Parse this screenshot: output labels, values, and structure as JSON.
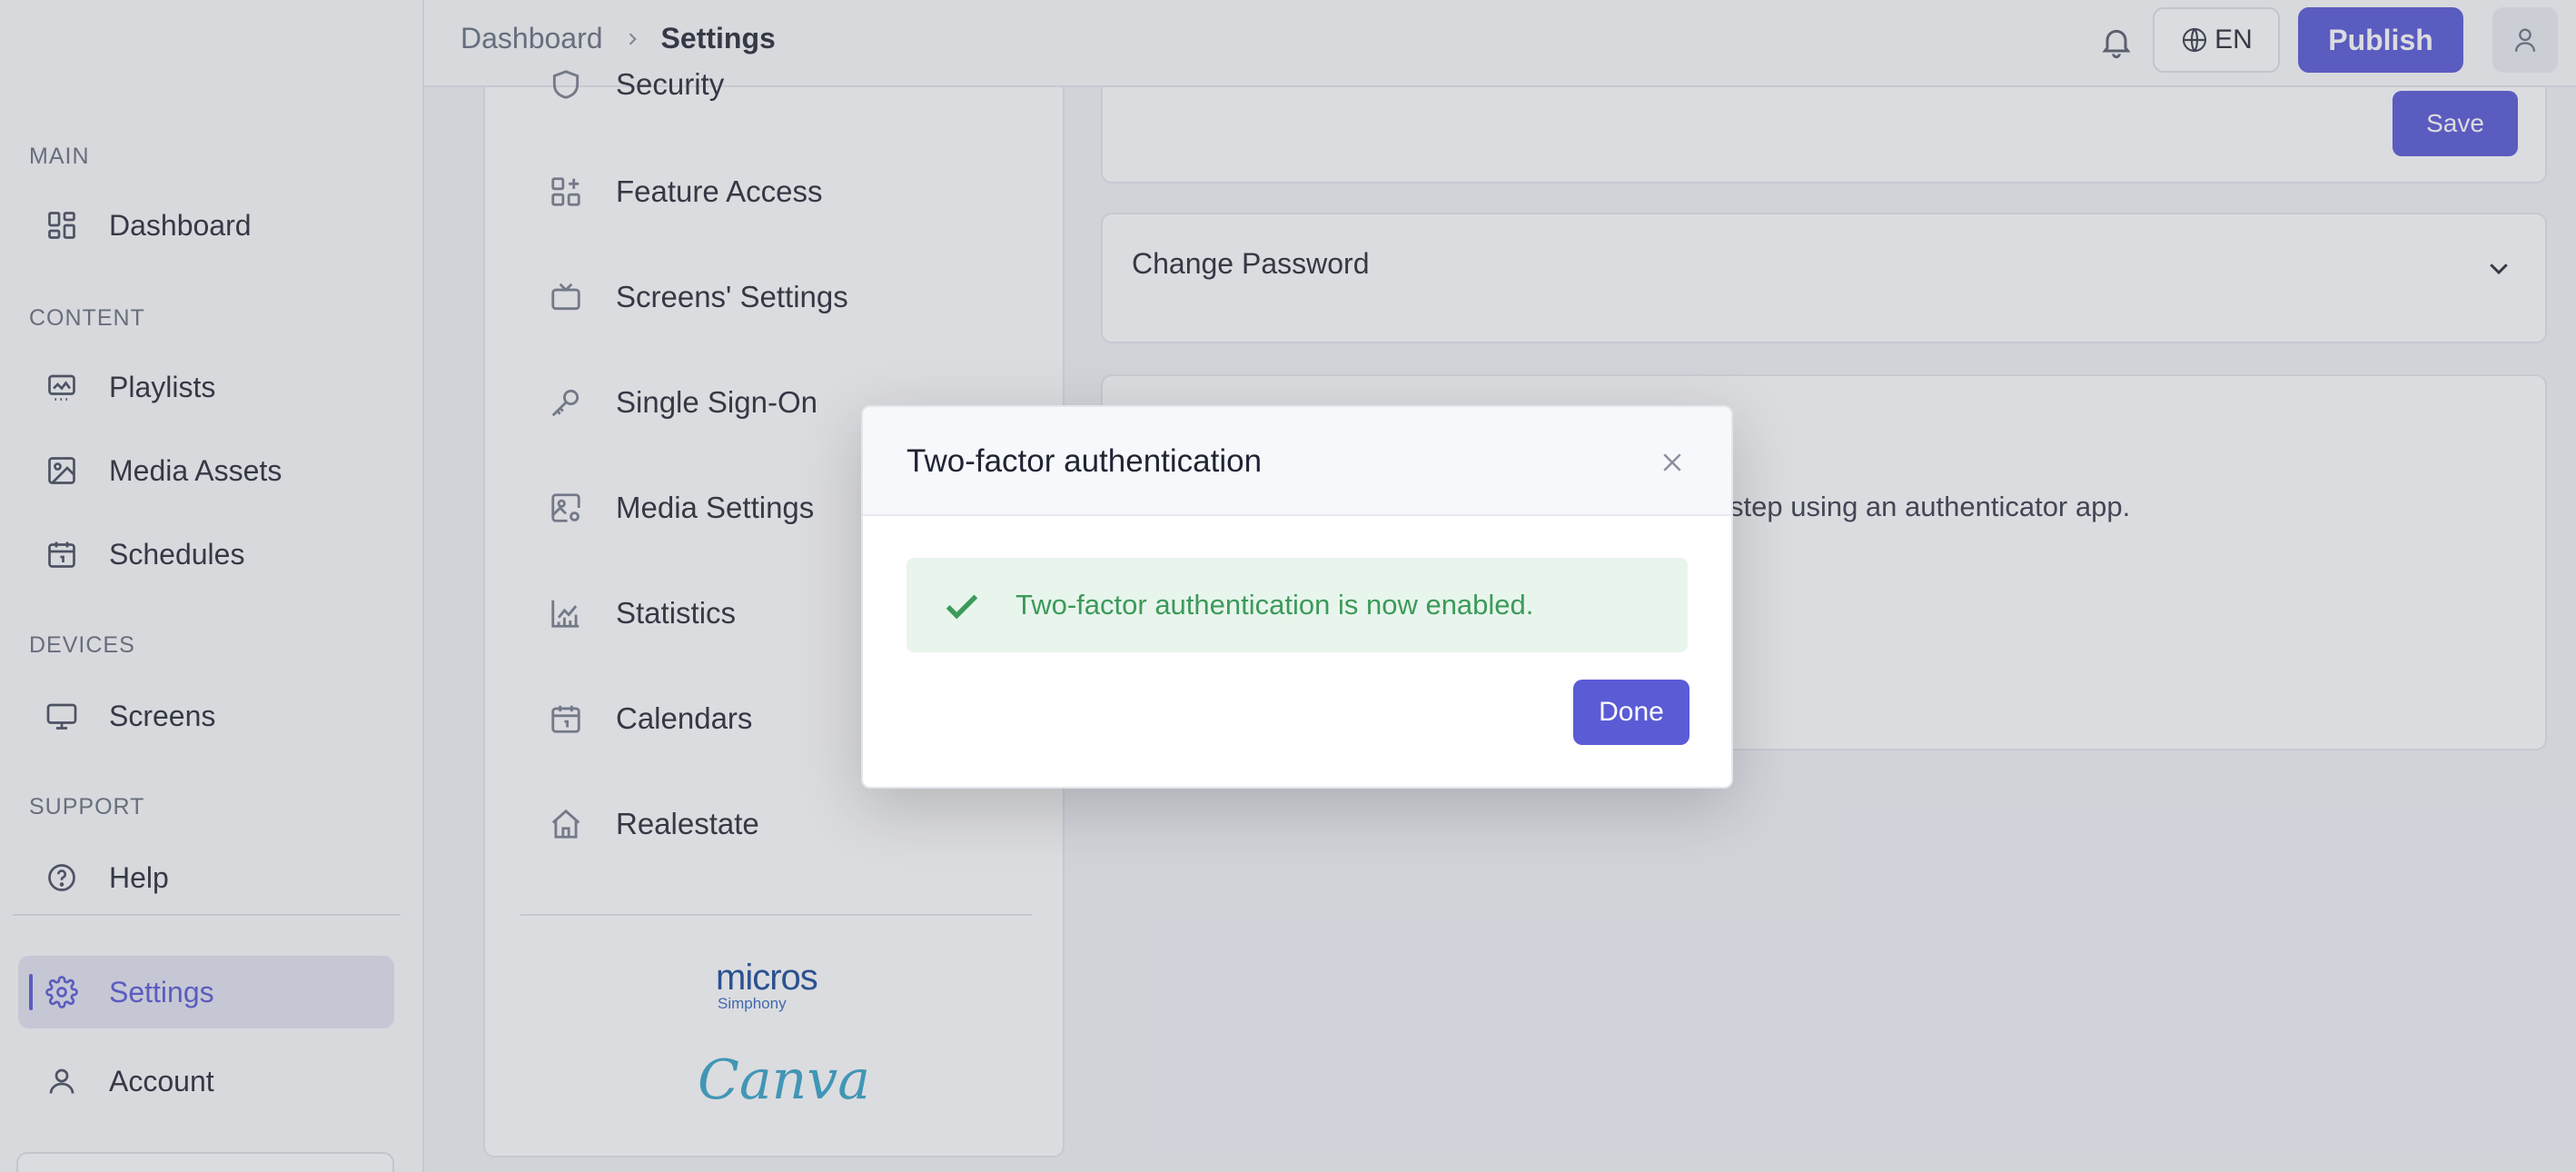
{
  "sidebar": {
    "sections": [
      {
        "label": "MAIN"
      },
      {
        "label": "CONTENT"
      },
      {
        "label": "DEVICES"
      },
      {
        "label": "SUPPORT"
      }
    ],
    "items": [
      {
        "label": "Dashboard",
        "icon": "dashboard-grid-icon"
      },
      {
        "label": "Playlists",
        "icon": "playlist-icon"
      },
      {
        "label": "Media Assets",
        "icon": "image-icon"
      },
      {
        "label": "Schedules",
        "icon": "calendar-icon"
      },
      {
        "label": "Screens",
        "icon": "monitor-icon"
      },
      {
        "label": "Help",
        "icon": "help-circle-icon"
      },
      {
        "label": "Settings",
        "icon": "gear-icon",
        "active": true
      },
      {
        "label": "Account",
        "icon": "user-icon"
      }
    ]
  },
  "topbar": {
    "breadcrumb_root": "Dashboard",
    "breadcrumb_current": "Settings",
    "language": "EN",
    "publish_label": "Publish"
  },
  "settings_nav": {
    "items": [
      {
        "label": "Security",
        "icon": "shield-icon"
      },
      {
        "label": "Feature Access",
        "icon": "feature-grid-icon"
      },
      {
        "label": "Screens' Settings",
        "icon": "tv-icon"
      },
      {
        "label": "Single Sign-On",
        "icon": "key-icon"
      },
      {
        "label": "Media Settings",
        "icon": "media-settings-icon"
      },
      {
        "label": "Statistics",
        "icon": "chart-icon"
      },
      {
        "label": "Calendars",
        "icon": "calendar-icon"
      },
      {
        "label": "Realestate",
        "icon": "home-icon"
      }
    ],
    "integrations": {
      "micros_word": "micros",
      "micros_sub": "Simphony",
      "canva_word": "Canva"
    }
  },
  "main": {
    "save_label": "Save",
    "change_password_title": "Change Password",
    "tfa_description_visible": "step using an authenticator app."
  },
  "modal": {
    "title": "Two-factor authentication",
    "success_message": "Two-factor authentication is now enabled.",
    "done_label": "Done"
  },
  "colors": {
    "accent": "#5b5bd6",
    "success_text": "#3c9a5a",
    "success_bg": "#e8f5ec"
  }
}
